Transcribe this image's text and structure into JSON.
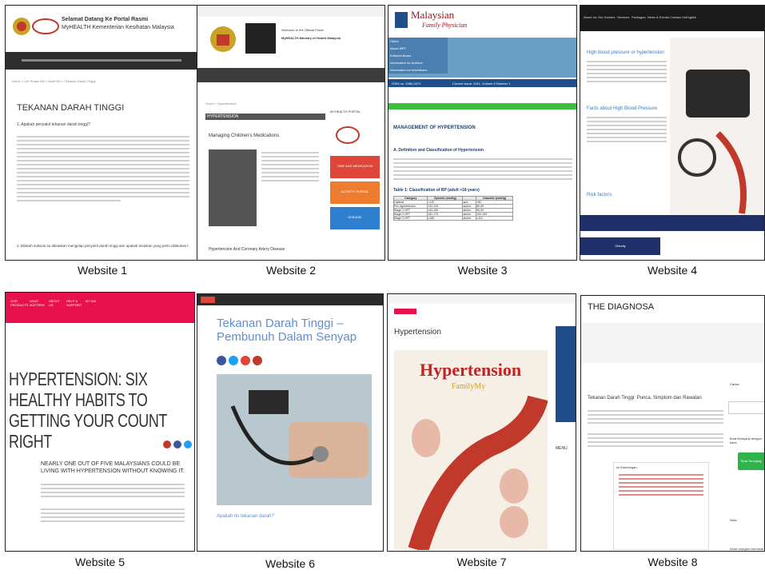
{
  "captions": [
    "Website 1",
    "Website 2",
    "Website 3",
    "Website 4",
    "Website 5",
    "Website 6",
    "Website 7",
    "Website 8"
  ],
  "site1": {
    "header_line1": "Selamat Datang Ke Portal Rasmi",
    "header_line2": "MyHEALTH Kementerian Kesihatan Malaysia",
    "breadcrumb": "Home » Life Phase Bin » Adult Bin » Tekanan Darah Tinggi",
    "title": "TEKANAN DARAH TINGGI",
    "question": "1. Apakah penyakit tekanan darah tinggi?",
    "question2": "2. Bilakah individu itu dikatakan mengidap penyakit darah tinggi dan apakah tindakan yang perlu dilakukan?"
  },
  "site2": {
    "org_line1": "Welcome to the Official Portal",
    "org_line2": "MyHEALTH Ministry of Health Malaysia",
    "breadcrumb": "Home » Hypertension",
    "section_label": "HYPERTENSION",
    "article1": "Managing Children's Medications",
    "article2": "Hypertension And Coronary Artery Disease",
    "sidebar_title": "MYHEALTH PORTAL",
    "sidebar_btn1": "TIME AND MEDICATION",
    "sidebar_btn2": "ACTIVITY PORTAL",
    "sidebar_btn3": "DISEASE"
  },
  "site3": {
    "logo_line1": "Malaysian",
    "logo_line2": "Family Physician",
    "sidebar_items": [
      "Home",
      "About MFP",
      "Editorial Board",
      "Information for Authors",
      "Information for Advertisers"
    ],
    "issn": "ISSN no: 1985-207X",
    "current_issue": "Current Issue: 2011, Volume 6 Number 1",
    "article_title": "MANAGEMENT OF HYPERTENSION",
    "section_a": "A. Definition and Classification of Hypertension",
    "table_title": "Table 1: Classification of BP (adult >18 years)",
    "table_headers": [
      "Category",
      "Systolic (mmHg)",
      "",
      "Diastolic (mmHg)"
    ],
    "table_rows": [
      [
        "Optimal",
        "<120",
        "and",
        "<80"
      ],
      [
        "Pre-hypertension",
        "120-139",
        "and/or",
        "80-89"
      ],
      [
        "Stage 1 HPT",
        "140-159",
        "and/or",
        "90-99"
      ],
      [
        "Stage 2 HPT",
        "160-179",
        "and/or",
        "100-109"
      ],
      [
        "Stage 3 HPT",
        "≥180",
        "and/or",
        "≥110"
      ]
    ]
  },
  "site4": {
    "nav_items": [
      "About Us",
      "Our Doctors",
      "Services",
      "Packages",
      "News & Events",
      "Contact Us",
      "English"
    ],
    "section1": "High blood pressure or hypertension",
    "section2": "Facts about High Blood Pressure",
    "section3": "Risk factors",
    "footer_left": "Obesity"
  },
  "site5": {
    "nav_items": [
      "OUR PRODUCTS",
      "WHAT MATTERS",
      "ABOUT US",
      "HELP & SUPPORT",
      "MY AIA"
    ],
    "headline": "HYPERTENSION: SIX HEALTHY HABITS TO GETTING YOUR COUNT RIGHT",
    "subheadline": "NEARLY ONE OUT OF FIVE MALAYSIANS COULD BE LIVING WITH HYPERTENSION WITHOUT KNOWING IT."
  },
  "site6": {
    "title": "Tekanan Darah Tinggi – Pembunuh Dalam Senyap",
    "caption": "Apakah itu tekanan darah?"
  },
  "site7": {
    "title": "Hypertension",
    "poster_title": "Hypertension",
    "poster_sub": "FamilyMy",
    "sidebar_label": "MENU"
  },
  "site8": {
    "logo": "THE DIAGNOSA",
    "title": "Tekanan Darah Tinggi: Punca, Simptom dan Rawatan",
    "sidebar_search": "Carian",
    "sidebar_q": "Buat temujanji dengan kami",
    "button": "Buat Temujanji",
    "sidebar_label1": "Nota",
    "sidebar_label2": "Anda mungkin berminat",
    "toc": "Isi Kandungan"
  },
  "colors": {
    "dark_nav": "#2e2e2e",
    "mfp_blue": "#6aa0c8",
    "mfp_green": "#3fbf3f",
    "aia_red": "#e8104d",
    "link_blue": "#5f8fd0",
    "poster_red": "#c81f1f",
    "cta_green": "#2eb44a"
  }
}
